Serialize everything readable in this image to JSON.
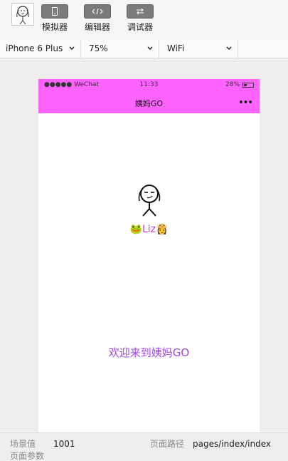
{
  "toolbar": {
    "avatar_icon": "stick-figure-avatar",
    "tools": [
      {
        "label": "模拟器",
        "icon": "phone-icon"
      },
      {
        "label": "编辑器",
        "icon": "code-icon"
      },
      {
        "label": "调试器",
        "icon": "arrows-icon"
      }
    ]
  },
  "selectors": {
    "device": "iPhone 6 Plus",
    "zoom": "75%",
    "network": "WiFi"
  },
  "phone": {
    "status": {
      "carrier": "●●●●● WeChat",
      "time": "11:33",
      "battery": "28%"
    },
    "nav_title": "姨妈GO",
    "more": "•••",
    "user_name": "🐸Liz👸",
    "welcome": "欢迎来到姨妈GO",
    "accent": "#ff63ff"
  },
  "footer": {
    "scene_label": "场景值",
    "scene_value": "1001",
    "path_label": "页面路径",
    "path_value": "pages/index/index",
    "params_label": "页面参数"
  }
}
